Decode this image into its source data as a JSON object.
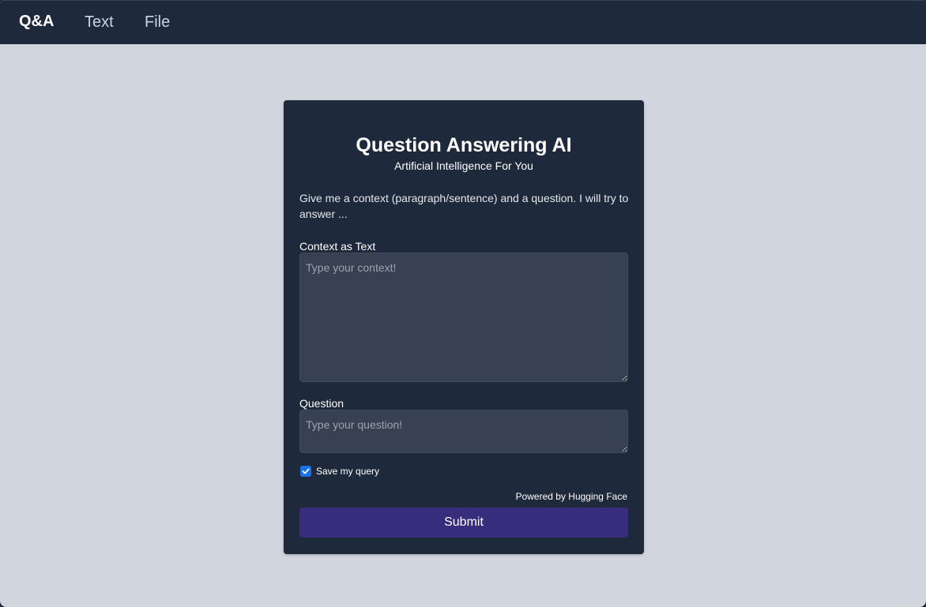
{
  "nav": {
    "brand": "Q&A",
    "links": [
      "Text",
      "File"
    ]
  },
  "card": {
    "title": "Question Answering AI",
    "subtitle": "Artificial Intelligence For You",
    "description": "Give me a context (paragraph/sentence) and a question. I will try to answer ...",
    "context": {
      "label": "Context as Text",
      "placeholder": "Type your context!",
      "value": ""
    },
    "question": {
      "label": "Question",
      "placeholder": "Type your question!",
      "value": ""
    },
    "save_query": {
      "label": "Save my query",
      "checked": true
    },
    "powered_by": "Powered by Hugging Face",
    "submit_label": "Submit"
  },
  "colors": {
    "page_background": "#d1d5de",
    "navbar": "#1e293b",
    "card": "#1e293b",
    "input_background": "#374151",
    "submit_button": "#372d7c",
    "checkbox": "#1a73e8"
  },
  "icons": {
    "checkbox": "checkmark-icon"
  }
}
